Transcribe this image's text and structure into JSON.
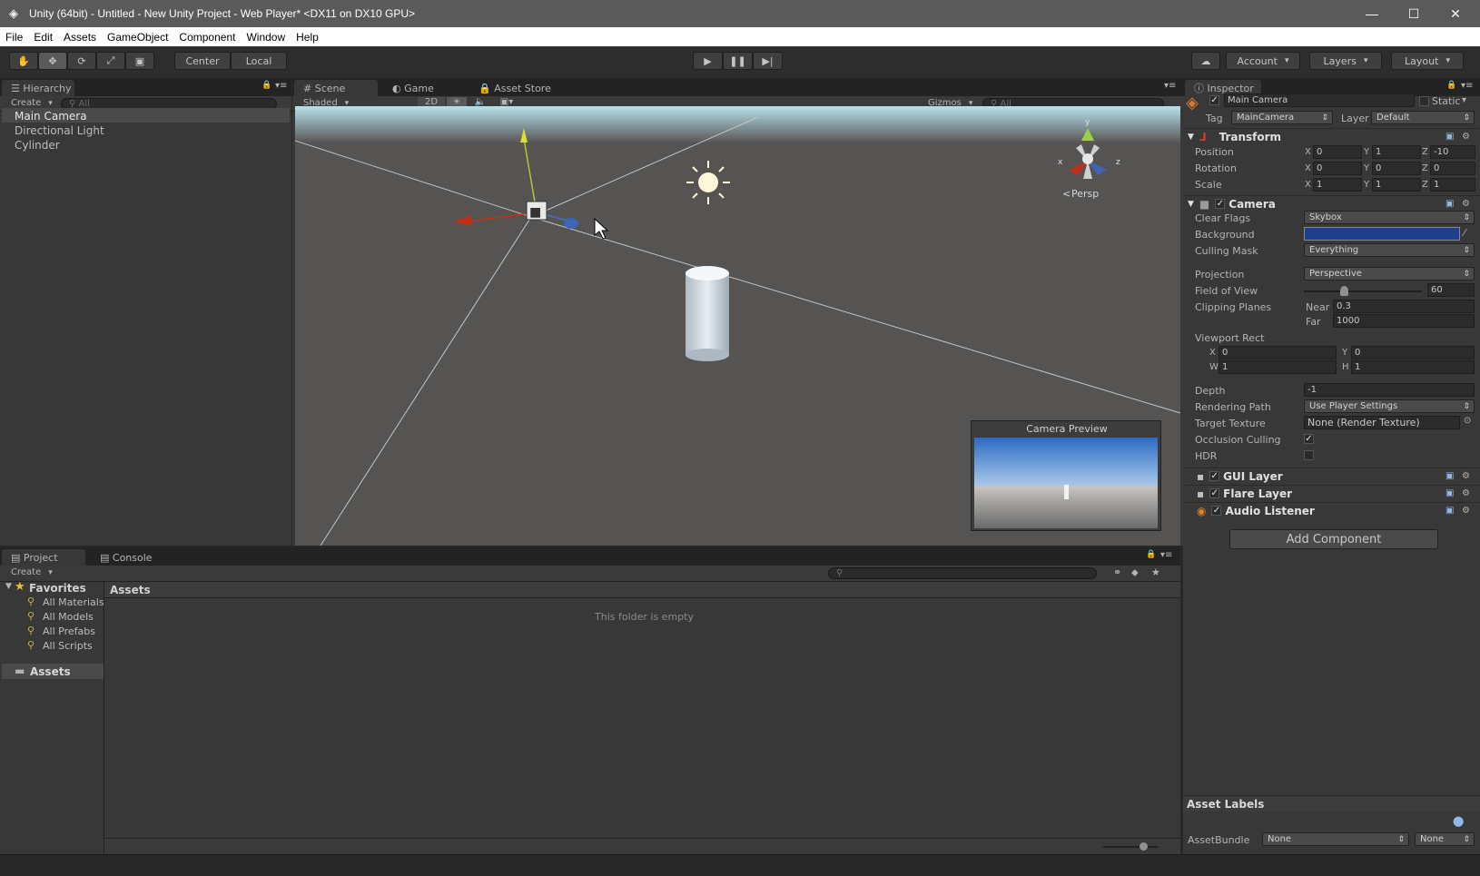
{
  "window": {
    "title": "Unity (64bit) - Untitled - New Unity Project - Web Player* <DX11 on DX10 GPU>",
    "minimize": "—",
    "maximize": "☐",
    "close": "✕"
  },
  "menu": [
    "File",
    "Edit",
    "Assets",
    "GameObject",
    "Component",
    "Window",
    "Help"
  ],
  "toolbar": {
    "pivot": "Center",
    "space": "Local",
    "account": "Account",
    "layers": "Layers",
    "layout": "Layout"
  },
  "hierarchy": {
    "tab": "Hierarchy",
    "create": "Create",
    "search": "All",
    "items": [
      "Main Camera",
      "Directional Light",
      "Cylinder"
    ]
  },
  "scene": {
    "tabs": [
      "Scene",
      "Game",
      "Asset Store"
    ],
    "shading": "Shaded",
    "mode2d": "2D",
    "gizmos": "Gizmos",
    "search": "All",
    "persp": "Persp",
    "preview_title": "Camera Preview"
  },
  "inspector": {
    "tab": "Inspector",
    "object_name": "Main Camera",
    "static": "Static",
    "tag_label": "Tag",
    "tag": "MainCamera",
    "layer_label": "Layer",
    "layer": "Default",
    "transform": {
      "title": "Transform",
      "position_label": "Position",
      "position": {
        "x": "0",
        "y": "1",
        "z": "-10"
      },
      "rotation_label": "Rotation",
      "rotation": {
        "x": "0",
        "y": "0",
        "z": "0"
      },
      "scale_label": "Scale",
      "scale": {
        "x": "1",
        "y": "1",
        "z": "1"
      }
    },
    "camera": {
      "title": "Camera",
      "clear_flags_label": "Clear Flags",
      "clear_flags": "Skybox",
      "background_label": "Background",
      "background_color": "#1f3f8c",
      "culling_label": "Culling Mask",
      "culling": "Everything",
      "projection_label": "Projection",
      "projection": "Perspective",
      "fov_label": "Field of View",
      "fov": "60",
      "clipping_label": "Clipping Planes",
      "near_label": "Near",
      "near": "0.3",
      "far_label": "Far",
      "far": "1000",
      "viewport_label": "Viewport Rect",
      "vx": "0",
      "vy": "0",
      "vw": "1",
      "vh": "1",
      "depth_label": "Depth",
      "depth": "-1",
      "rendering_label": "Rendering Path",
      "rendering": "Use Player Settings",
      "target_label": "Target Texture",
      "target": "None (Render Texture)",
      "occlusion_label": "Occlusion Culling",
      "hdr_label": "HDR"
    },
    "components": [
      "GUI Layer",
      "Flare Layer",
      "Audio Listener"
    ],
    "add_component": "Add Component",
    "asset_labels": "Asset Labels",
    "assetbundle_label": "AssetBundle",
    "assetbundle": "None",
    "assetbundle_variant": "None"
  },
  "project": {
    "tabs": [
      "Project",
      "Console"
    ],
    "create": "Create",
    "favorites": "Favorites",
    "fav_items": [
      "All Materials",
      "All Models",
      "All Prefabs",
      "All Scripts"
    ],
    "assets_tree": "Assets",
    "breadcrumb": "Assets",
    "empty": "This folder is empty"
  }
}
